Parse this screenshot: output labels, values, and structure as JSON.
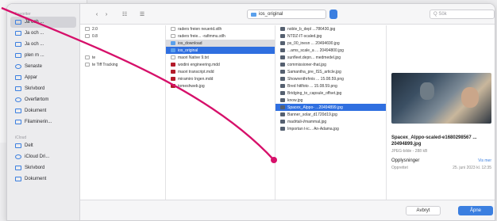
{
  "toolbar": {
    "back": "‹",
    "forward": "›",
    "view_label": "☷",
    "group_label": "☰",
    "location": "ios_original",
    "search_placeholder": "Q Sök"
  },
  "sidebar": {
    "favorites_heading": "Favoriter",
    "items": [
      {
        "label": "Ja och ...",
        "selected": true
      },
      {
        "label": "Ja och ...",
        "selected": false
      },
      {
        "label": "Ja och ...",
        "selected": false
      },
      {
        "label": "plen m ...",
        "selected": false
      },
      {
        "label": "Senaste",
        "selected": false
      },
      {
        "label": "Appar",
        "selected": false
      },
      {
        "label": "Skrivbord",
        "selected": false
      },
      {
        "label": "Overførtom",
        "selected": false
      },
      {
        "label": "Dokument",
        "selected": false
      },
      {
        "label": "Filaminerin...",
        "selected": false
      }
    ],
    "icloud_heading": "iCloud",
    "icloud_items": [
      {
        "label": "Delt"
      },
      {
        "label": "iCloud Dri..."
      },
      {
        "label": "Skrivbord"
      },
      {
        "label": "Dokument"
      }
    ]
  },
  "columns": {
    "col1": [
      {
        "label": "2.0",
        "icon": "doc"
      },
      {
        "label": "0.8",
        "icon": "doc"
      },
      {
        "label": "",
        "icon": ""
      },
      {
        "label": "",
        "icon": ""
      },
      {
        "label": "te",
        "icon": "doc"
      },
      {
        "label": "te Tiff Tracking",
        "icon": "doc"
      }
    ],
    "col2": [
      {
        "label": "raders freien neuerid.stlh",
        "icon": "doc",
        "state": ""
      },
      {
        "label": "raders freie... -rafimmu.stlh",
        "icon": "doc",
        "state": ""
      },
      {
        "label": "ios_download",
        "icon": "folder",
        "state": "hl"
      },
      {
        "label": "ios_original",
        "icon": "folder",
        "state": "sel"
      },
      {
        "label": "maori Native 9.txt",
        "icon": "doc",
        "state": ""
      },
      {
        "label": "wodini engineering.mdd",
        "icon": "red",
        "state": ""
      },
      {
        "label": "maori transcript.mdd",
        "icon": "red",
        "state": ""
      },
      {
        "label": "miramiro Ingen.mdd",
        "icon": "red",
        "state": ""
      },
      {
        "label": "tomeshweb.jpg",
        "icon": "red",
        "state": ""
      }
    ],
    "col3": [
      {
        "label": "noble_b_depl ...786430.jpg",
        "state": ""
      },
      {
        "label": "NTDZ-IT-scaled.jpg",
        "state": ""
      },
      {
        "label": "ps_00_inesn ... 20494690.jpg",
        "state": ""
      },
      {
        "label": "...ams_scale_a ... 20494800.jpg",
        "state": ""
      },
      {
        "label": "sunfleet.depn... medmedel.jpg",
        "state": ""
      },
      {
        "label": "commissioner-that.jpg",
        "state": ""
      },
      {
        "label": "Samantha_pre_ISS_article.jpg",
        "state": ""
      },
      {
        "label": "Showrenthrhnis ... 15.08.59.png",
        "state": ""
      },
      {
        "label": "Bred hitlfoto ... 15.08.59.png",
        "state": ""
      },
      {
        "label": "Bridging_to_capsule_offset.jpg",
        "state": ""
      },
      {
        "label": "know.jpg",
        "state": ""
      },
      {
        "label": "Spacex_Alppo- ...20494899.jpg",
        "state": "sel"
      },
      {
        "label": "Banner_solar_d1720d19.jpg",
        "state": ""
      },
      {
        "label": "madrtali-i/mammal.jpg",
        "state": ""
      },
      {
        "label": "Importan t-ic... An-Adama.jpg",
        "state": ""
      }
    ]
  },
  "preview": {
    "name": "Spacex_Alppo-scaled-e1680298567 ... 20494899.jpg",
    "meta": "JPEG-bilde - 288 kB",
    "info_heading": "Opplysninger",
    "more": "Vis mer",
    "created_label": "Opprettet",
    "created_value": "25. juni 2023 kl. 12:35"
  },
  "footer": {
    "cancel": "Avbryt",
    "open": "Åpne"
  },
  "colors": {
    "accent": "#3b7fe0",
    "selection": "#2f6fe0",
    "annotation": "#d6106a"
  }
}
